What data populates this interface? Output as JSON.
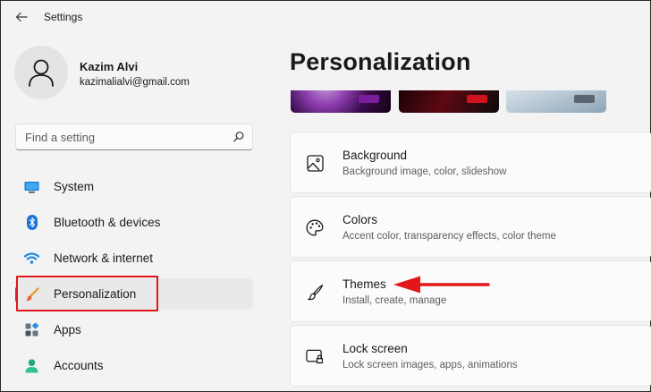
{
  "window": {
    "title": "Settings"
  },
  "profile": {
    "name": "Kazim Alvi",
    "email": "kazimalialvi@gmail.com"
  },
  "search": {
    "placeholder": "Find a setting"
  },
  "sidebar": {
    "items": [
      {
        "label": "System",
        "icon": "monitor-icon"
      },
      {
        "label": "Bluetooth & devices",
        "icon": "bluetooth-icon"
      },
      {
        "label": "Network & internet",
        "icon": "wifi-icon"
      },
      {
        "label": "Personalization",
        "icon": "paintbrush-icon",
        "selected": true
      },
      {
        "label": "Apps",
        "icon": "apps-icon"
      },
      {
        "label": "Accounts",
        "icon": "person-icon"
      }
    ]
  },
  "main": {
    "title": "Personalization",
    "themes": [
      {
        "name": "theme-purple",
        "accent": "#7b1e9e"
      },
      {
        "name": "theme-red",
        "accent": "#d0141c"
      },
      {
        "name": "theme-light",
        "accent": "#5b6571"
      }
    ],
    "cards": [
      {
        "title": "Background",
        "subtitle": "Background image, color, slideshow",
        "icon": "image-icon"
      },
      {
        "title": "Colors",
        "subtitle": "Accent color, transparency effects, color theme",
        "icon": "palette-icon"
      },
      {
        "title": "Themes",
        "subtitle": "Install, create, manage",
        "icon": "brush-icon"
      },
      {
        "title": "Lock screen",
        "subtitle": "Lock screen images, apps, animations",
        "icon": "lock-screen-icon"
      }
    ]
  },
  "colors": {
    "accent": "#1a6fc0",
    "annotation": "#e3171b",
    "background": "#f3f3f3"
  }
}
